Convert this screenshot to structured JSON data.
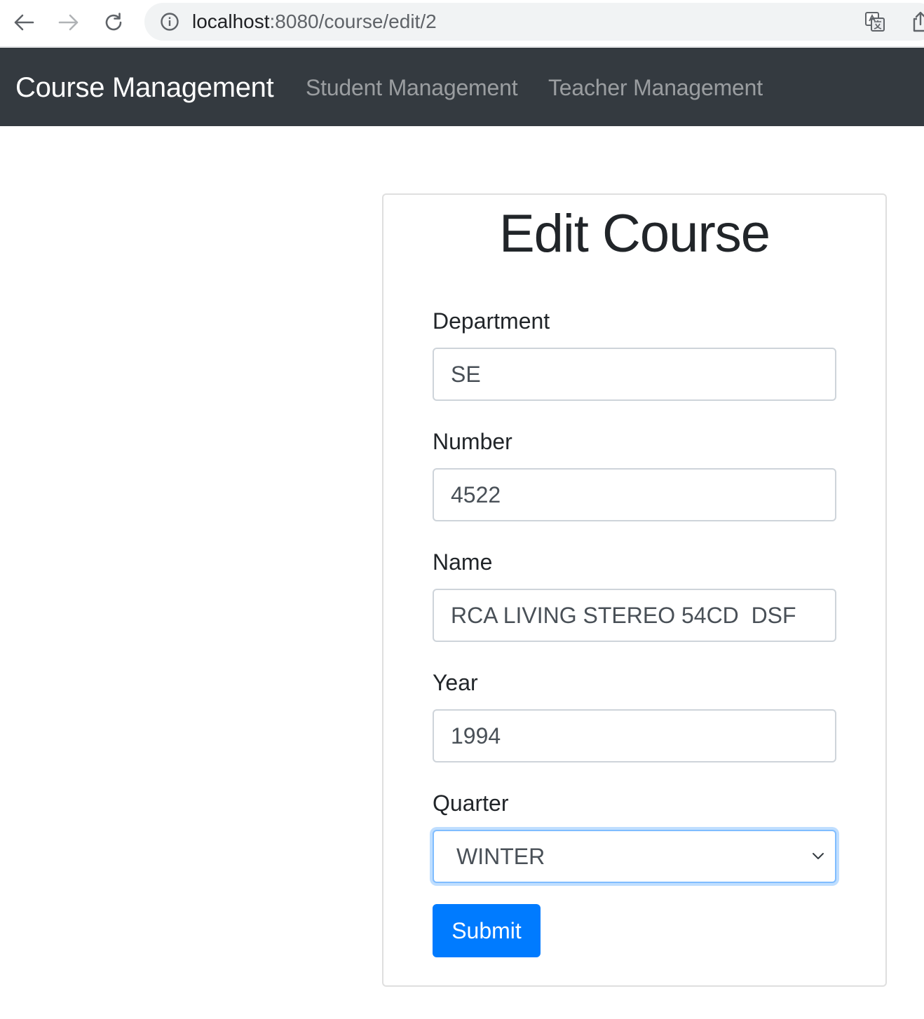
{
  "browser": {
    "url_host": "localhost",
    "url_path": ":8080/course/edit/2",
    "icons": {
      "back": "arrow-left-icon",
      "forward": "arrow-right-icon",
      "reload": "reload-icon",
      "info": "info-icon",
      "translate": "translate-icon",
      "share": "share-icon"
    }
  },
  "navbar": {
    "brand": "Course Management",
    "links": [
      "Student Management",
      "Teacher Management"
    ],
    "background_color": "#343a40"
  },
  "form": {
    "title": "Edit Course",
    "department": {
      "label": "Department",
      "value": "SE"
    },
    "number": {
      "label": "Number",
      "value": "4522"
    },
    "name": {
      "label": "Name",
      "value": "RCA LIVING STEREO 54CD  DSF"
    },
    "year": {
      "label": "Year",
      "value": "1994"
    },
    "quarter": {
      "label": "Quarter",
      "value": "WINTER"
    },
    "submit_label": "Submit",
    "accent_color": "#007bff"
  }
}
